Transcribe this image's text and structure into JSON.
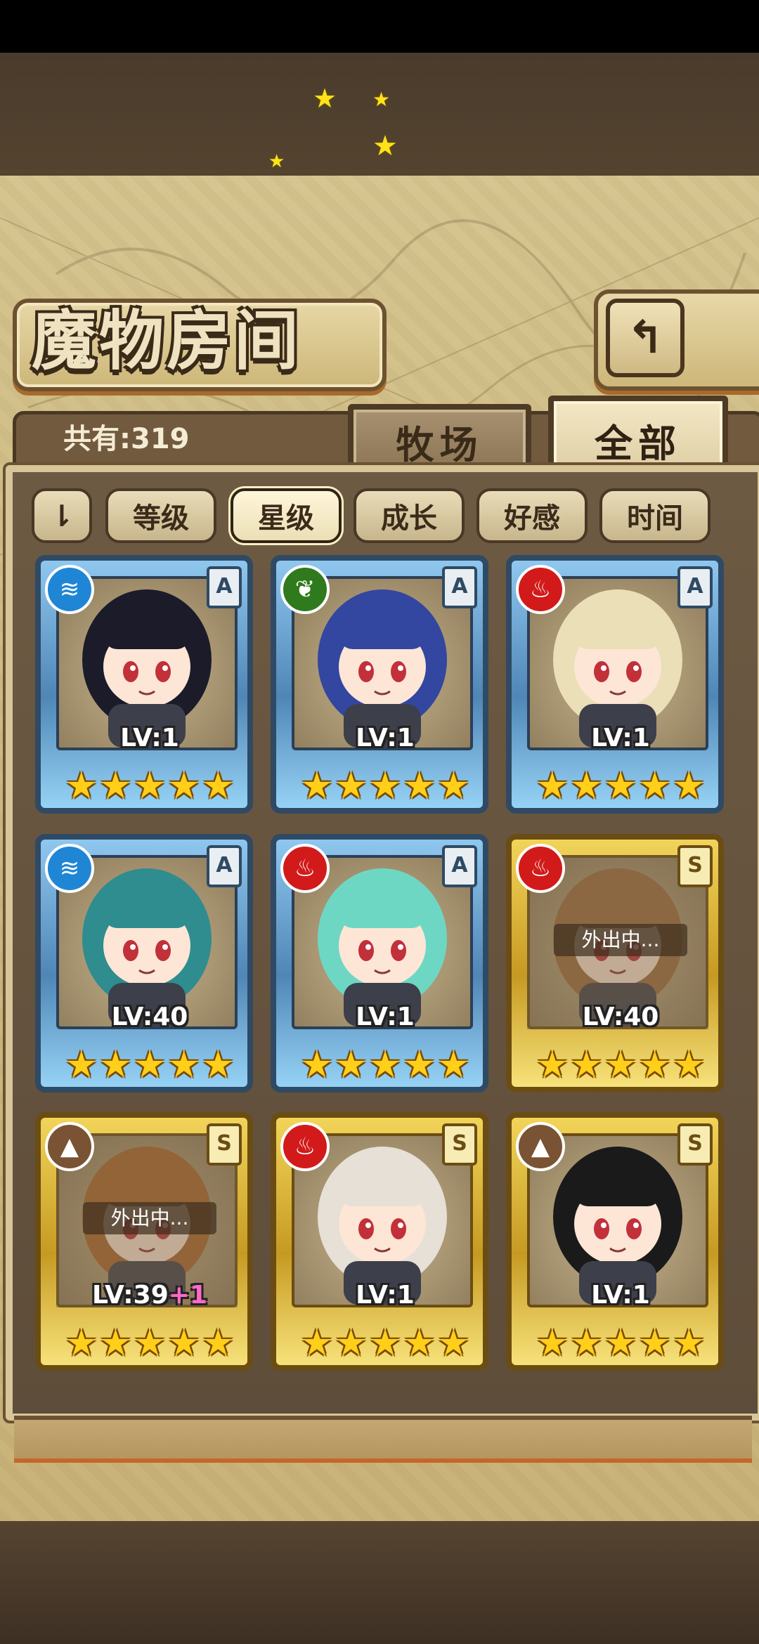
{
  "title": "魔物房间",
  "total_count_label": "共有:319",
  "tabs": [
    {
      "label": "牧场",
      "active": false
    },
    {
      "label": "全部",
      "active": true
    }
  ],
  "sort_buttons": [
    {
      "label": "等级",
      "active": false
    },
    {
      "label": "星级",
      "active": true
    },
    {
      "label": "成长",
      "active": false
    },
    {
      "label": "好感",
      "active": false
    },
    {
      "label": "时间",
      "active": false
    }
  ],
  "cards": [
    {
      "element": "water-icon",
      "rank": "A",
      "level": "LV:1",
      "plus": "",
      "stars": 5,
      "away": false,
      "frame": "blue"
    },
    {
      "element": "leaf-icon",
      "rank": "A",
      "level": "LV:1",
      "plus": "",
      "stars": 5,
      "away": false,
      "frame": "blue"
    },
    {
      "element": "fire-icon",
      "rank": "A",
      "level": "LV:1",
      "plus": "",
      "stars": 5,
      "away": false,
      "frame": "blue"
    },
    {
      "element": "water-icon",
      "rank": "A",
      "level": "LV:40",
      "plus": "",
      "stars": 5,
      "away": false,
      "frame": "blue"
    },
    {
      "element": "fire-icon",
      "rank": "A",
      "level": "LV:1",
      "plus": "",
      "stars": 5,
      "away": false,
      "frame": "blue"
    },
    {
      "element": "fire-icon",
      "rank": "S",
      "level": "LV:40",
      "plus": "",
      "stars": 5,
      "away": true,
      "away_text": "外出中...",
      "frame": "gold"
    },
    {
      "element": "mountain-icon",
      "rank": "S",
      "level": "LV:39",
      "plus": "+1",
      "stars": 5,
      "away": true,
      "away_text": "外出中...",
      "frame": "gold"
    },
    {
      "element": "fire-icon",
      "rank": "S",
      "level": "LV:1",
      "plus": "",
      "stars": 5,
      "away": false,
      "frame": "gold"
    },
    {
      "element": "mountain-icon",
      "rank": "S",
      "level": "LV:1",
      "plus": "",
      "stars": 5,
      "away": false,
      "frame": "gold"
    }
  ],
  "colors": {
    "parchment": "#cbb87f",
    "frame_blue": "#4f86b6",
    "frame_gold": "#c69a22",
    "star": "#ffcf1a"
  }
}
